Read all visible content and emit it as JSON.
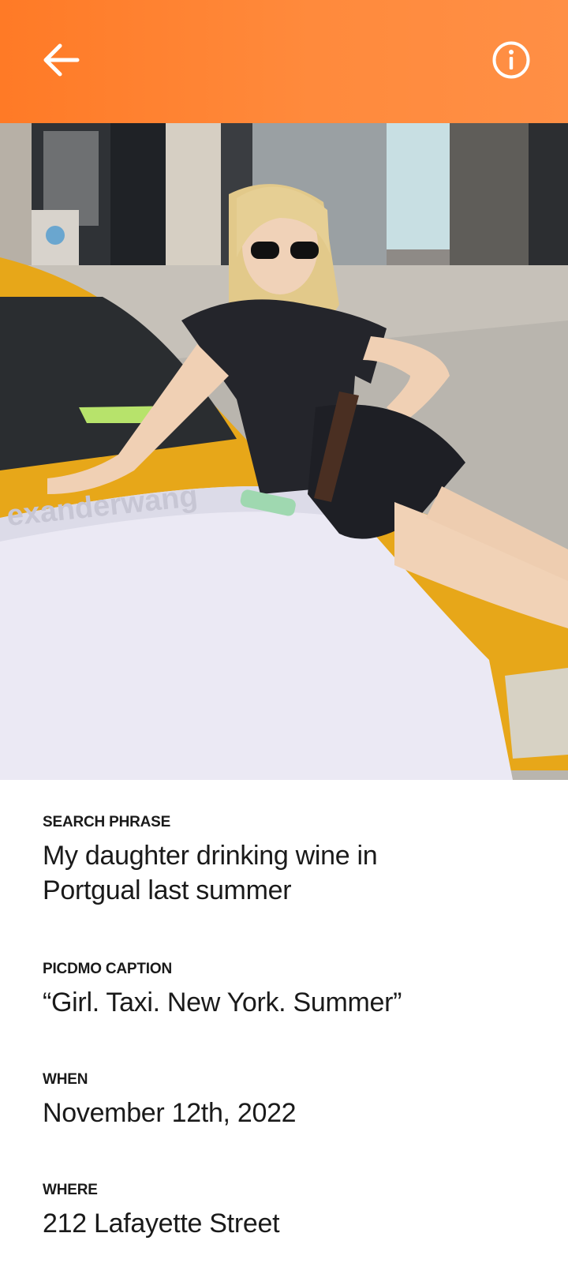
{
  "header": {
    "back_icon": "arrow-left-icon",
    "info_icon": "info-circle-icon",
    "background_color": "#ff8233"
  },
  "photo": {
    "watermark_text": "exanderwang"
  },
  "details": {
    "search_phrase": {
      "label": "SEARCH PHRASE",
      "value_line1": "My daughter drinking wine in",
      "value_line2": "Portgual last summer"
    },
    "caption": {
      "label": "PICDMO CAPTION",
      "value": "“Girl. Taxi. New York. Summer”"
    },
    "when": {
      "label": "WHEN",
      "value": "November 12th, 2022"
    },
    "where": {
      "label": "WHERE",
      "value": "212 Lafayette Street"
    }
  }
}
